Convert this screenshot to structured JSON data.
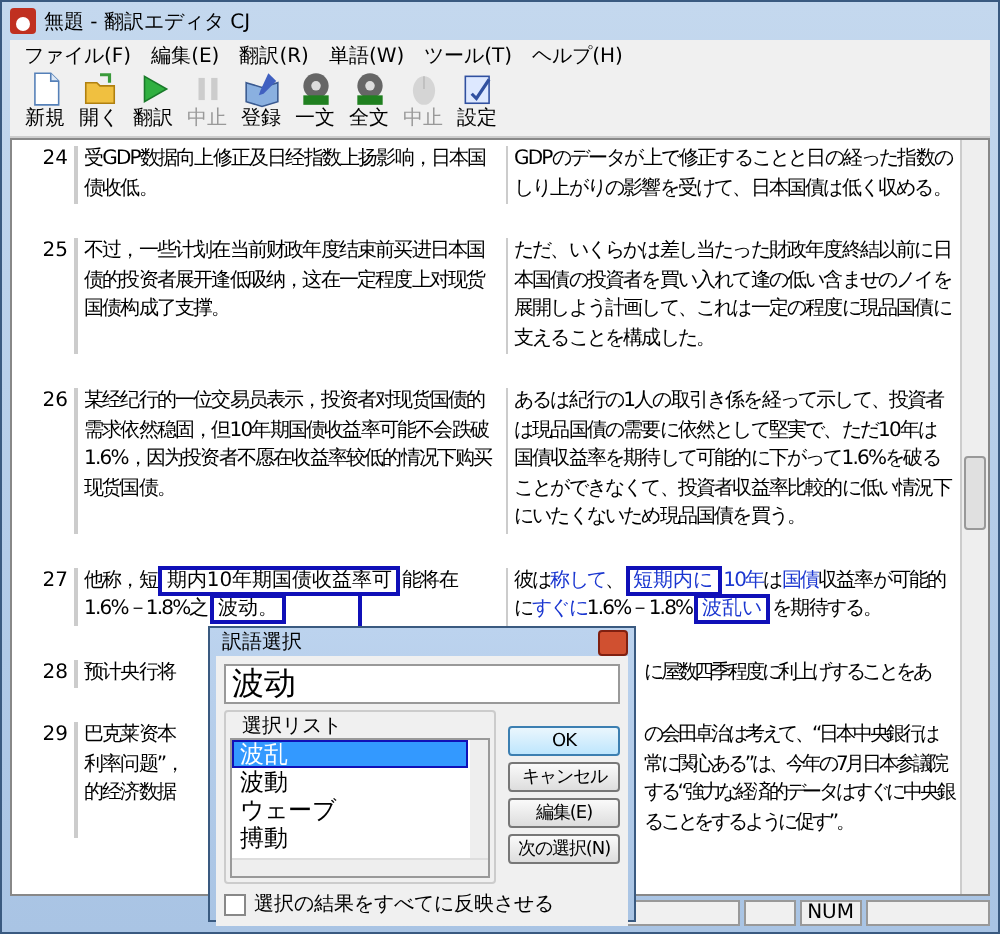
{
  "window": {
    "title": "無題 - 翻訳エディタ CJ"
  },
  "menu": [
    "ファイル(F)",
    "編集(E)",
    "翻訳(R)",
    "単語(W)",
    "ツール(T)",
    "ヘルプ(H)"
  ],
  "toolbar": [
    {
      "label": "新規",
      "disabled": false
    },
    {
      "label": "開く",
      "disabled": false
    },
    {
      "label": "翻訳",
      "disabled": false
    },
    {
      "label": "中止",
      "disabled": true
    },
    {
      "label": "登録",
      "disabled": false
    },
    {
      "label": "一文",
      "disabled": false
    },
    {
      "label": "全文",
      "disabled": false
    },
    {
      "label": "中止",
      "disabled": true
    },
    {
      "label": "設定",
      "disabled": false
    }
  ],
  "rows": [
    {
      "kind": "plain",
      "number": "24",
      "source": "受GDP数据向上修正及日经指数上扬影响，日本国债收低。",
      "target": "GDPのデータが上で修正することと日の経った指数のしり上がりの影響を受けて、日本国債は低く収める。"
    },
    {
      "kind": "plain",
      "number": "25",
      "source": "不过，一些计划在当前财政年度结束前买进日本国债的投资者展开逢低吸纳，这在一定程度上对现货国债构成了支撑。",
      "target": "ただ、いくらかは差し当たった財政年度終結以前に日本国債の投資者を買い入れて逢の低い含ませのノイを展開しよう計画して、これは一定の程度に現品国債に支えることを構成した。"
    },
    {
      "kind": "plain",
      "number": "26",
      "source": "某经纪行的一位交易员表示，投资者对现货国债的需求依然稳固，但10年期国债收益率可能不会跌破1.6%，因为投资者不愿在收益率较低的情况下购买现货国债。",
      "target": "あるは紀行の1人の取引き係を経って示して、投資者は現品国債の需要に依然として堅実で、ただ10年は国債収益率を期待して可能的に下がって1.6%を破ることができなくて、投資者収益率比較的に低い情況下にいたくないため現品国債を買う。"
    },
    {
      "kind": "aligned",
      "number": "27",
      "source_segments": [
        {
          "text": "他称，短",
          "link": false,
          "boxed": false
        },
        {
          "text": "期内10年期国债收益率可",
          "link": false,
          "boxed": true
        },
        {
          "text": "能将在1.6%－1.8%之",
          "link": false,
          "boxed": false
        },
        {
          "text": "波动。",
          "link": false,
          "boxed": true
        }
      ],
      "target_segments": [
        {
          "text": "彼は",
          "link": false,
          "boxed": false
        },
        {
          "text": "称して",
          "link": true,
          "boxed": false
        },
        {
          "text": "、",
          "link": false,
          "boxed": false
        },
        {
          "text": "短期内に",
          "link": true,
          "boxed": true
        },
        {
          "text": "10年",
          "link": true,
          "boxed": false
        },
        {
          "text": "は",
          "link": false,
          "boxed": false
        },
        {
          "text": "国債",
          "link": true,
          "boxed": false
        },
        {
          "text": "収益率が可能的に",
          "link": false,
          "boxed": false
        },
        {
          "text": "すぐに",
          "link": true,
          "boxed": false
        },
        {
          "text": "1.6%－1.8%",
          "link": false,
          "boxed": false
        },
        {
          "text": "波乱い",
          "link": true,
          "boxed": true
        },
        {
          "text": "を期待する。",
          "link": false,
          "boxed": false
        }
      ]
    },
    {
      "kind": "covered",
      "number": "28",
      "source_lines": [
        "预计央行将"
      ],
      "target_lines": [
        "に屋数四季程度に利上げすることをあ"
      ]
    },
    {
      "kind": "covered",
      "number": "29",
      "source_lines": [
        "巴克莱资本",
        "利率问题”，",
        "的经济数据"
      ],
      "target_lines": [
        "の会田卓治は考えて、“日本中央銀行は",
        "常に関心ある”は、今年の7月日本参議院",
        "する“強力な経済的データはすぐに中央銀",
        "ることをするように促す”。"
      ]
    }
  ],
  "dialog": {
    "title": "訳語選択",
    "value": "波动",
    "list_label": "選択リスト",
    "items": [
      {
        "label": "波乱",
        "selected": true
      },
      {
        "label": "波動",
        "selected": false
      },
      {
        "label": "ウェーブ",
        "selected": false
      },
      {
        "label": "搏動",
        "selected": false
      }
    ],
    "buttons": [
      "OK",
      "キャンセル",
      "編集(E)",
      "次の選択(N)"
    ],
    "checkbox": {
      "label": "選択の結果をすべてに反映させる",
      "checked": false
    }
  },
  "status_bar": {
    "indicator": "NUM"
  }
}
